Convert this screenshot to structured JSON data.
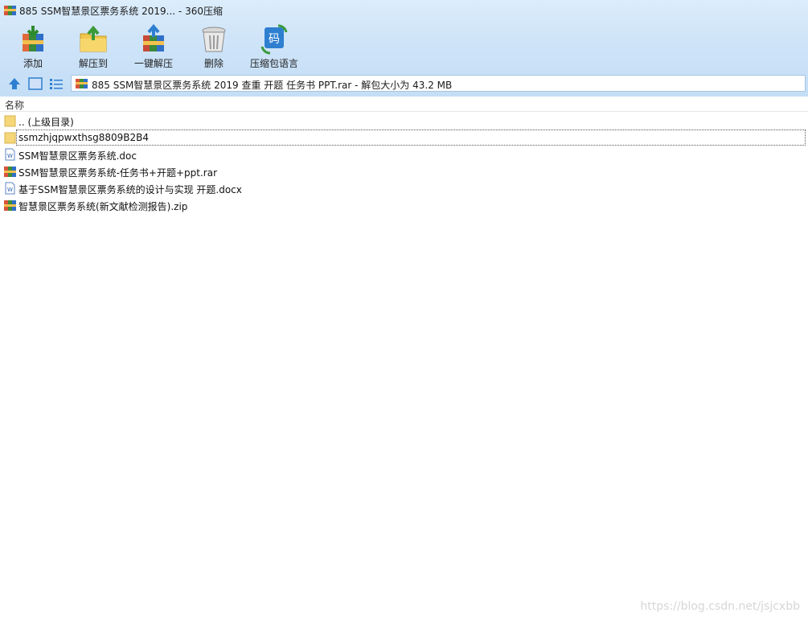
{
  "window": {
    "title": "885 SSM智慧景区票务系统  2019... - 360压缩"
  },
  "toolbar": {
    "add": "添加",
    "extract_to": "解压到",
    "one_click_extract": "一键解压",
    "delete": "删除",
    "archive_language": "压缩包语言",
    "language_icon_glyph": "码"
  },
  "navbar": {
    "address": "885 SSM智慧景区票务系统  2019 查重  开题 任务书 PPT.rar - 解包大小为 43.2 MB"
  },
  "list": {
    "column_name": "名称",
    "items": [
      {
        "name": ".. (上级目录)",
        "icon": "folder-icon"
      },
      {
        "name": "ssmzhjqpwxthsg8809B2B4",
        "icon": "folder-icon"
      },
      {
        "name": "SSM智慧景区票务系统.doc",
        "icon": "word-doc-icon"
      },
      {
        "name": "SSM智慧景区票务系统-任务书+开题+ppt.rar",
        "icon": "rar-archive-icon"
      },
      {
        "name": "基于SSM智慧景区票务系统的设计与实现  开题.docx",
        "icon": "word-doc-icon"
      },
      {
        "name": "智慧景区票务系统(新文献检测报告).zip",
        "icon": "zip-archive-icon"
      }
    ]
  },
  "watermark": "https://blog.csdn.net/jsjcxbb",
  "colors": {
    "toolbar_bg": "#cfe4f8",
    "folder": "#f5d77a",
    "accent": "#2f7fd1"
  }
}
